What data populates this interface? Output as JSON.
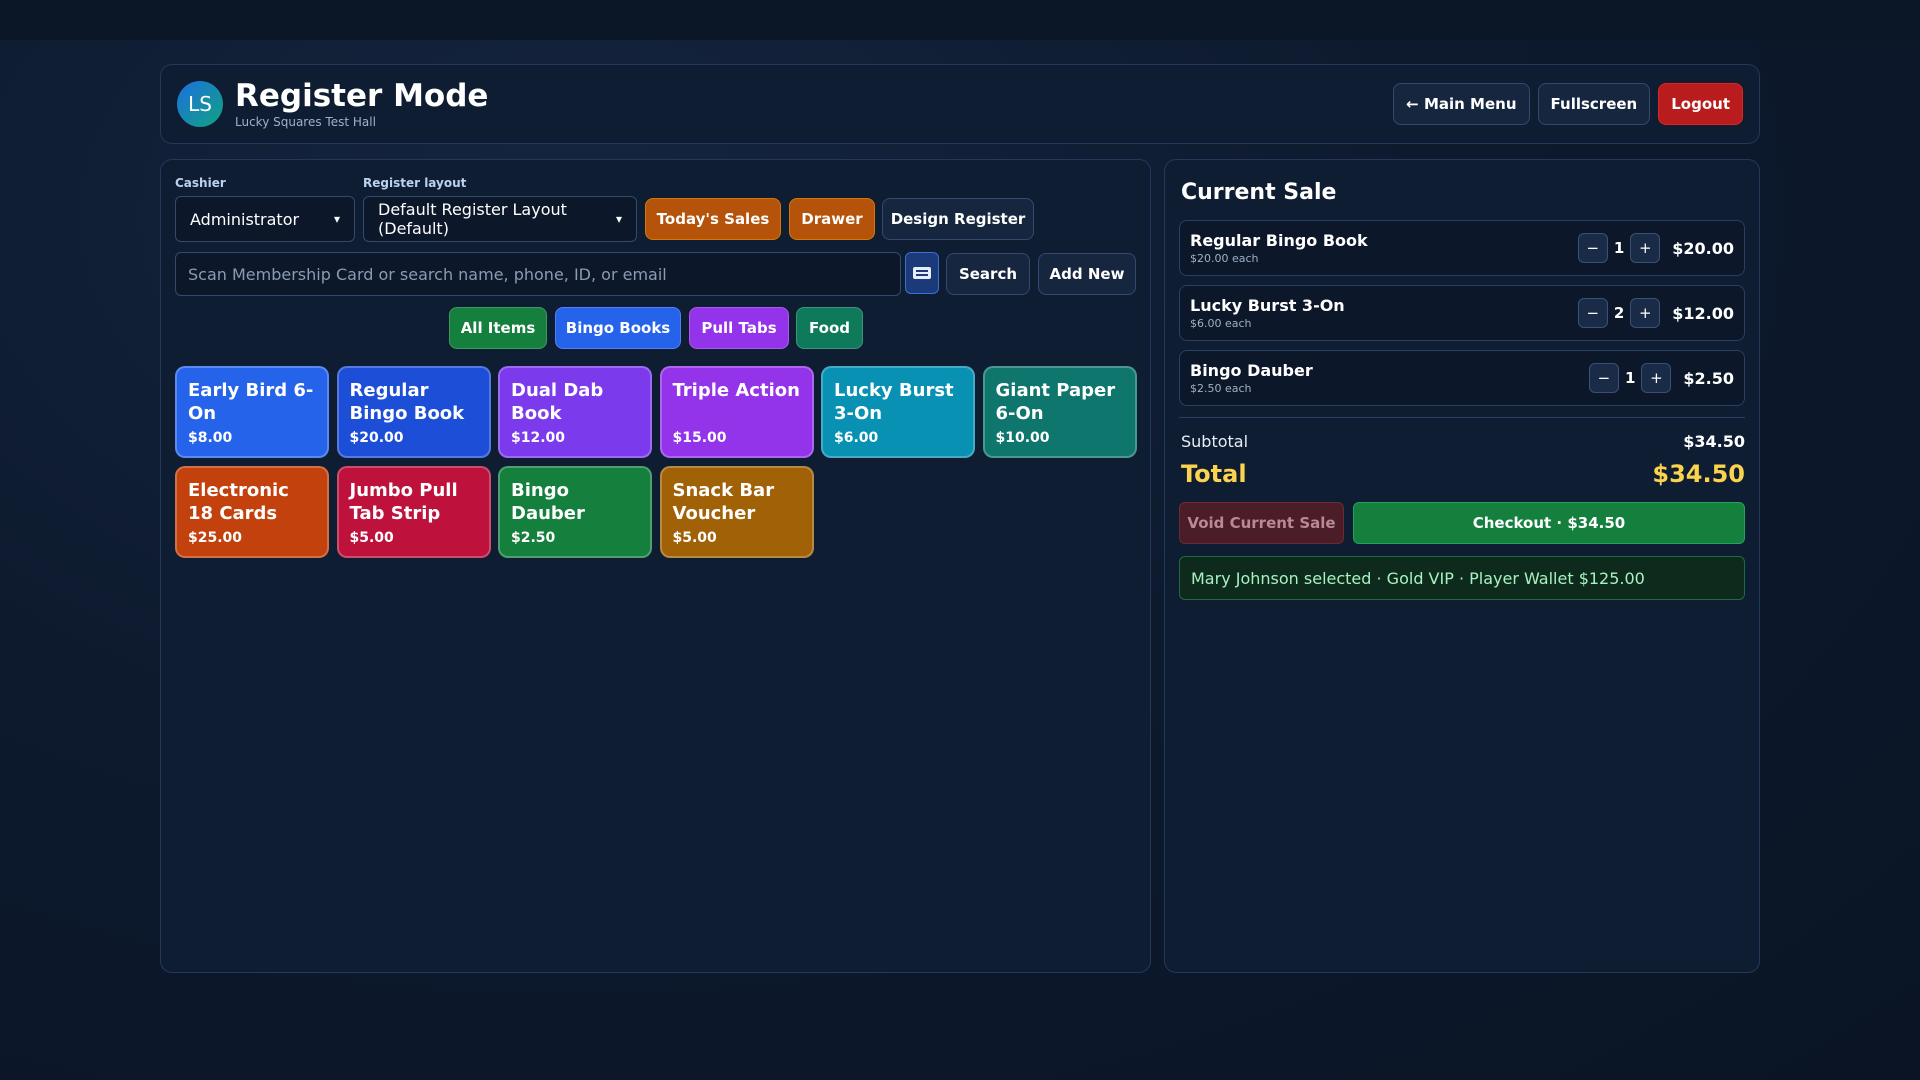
{
  "header": {
    "logo_initials": "LS",
    "title": "Register Mode",
    "subtitle": "Lucky Squares Test Hall",
    "buttons": {
      "main_menu": "← Main Menu",
      "fullscreen": "Fullscreen",
      "logout": "Logout"
    }
  },
  "controls": {
    "cashier_label": "Cashier",
    "cashier_value": "Administrator",
    "layout_label": "Register layout",
    "layout_value": "Default Register Layout (Default)",
    "todays_sales": "Today's Sales",
    "drawer": "Drawer",
    "design_register": "Design Register",
    "search_placeholder": "Scan Membership Card or search name, phone, ID, or email",
    "search_button": "Search",
    "add_new_button": "Add New"
  },
  "categories": [
    {
      "label": "All Items",
      "color": "#15803d"
    },
    {
      "label": "Bingo Books",
      "color": "#2563eb"
    },
    {
      "label": "Pull Tabs",
      "color": "#9333ea"
    },
    {
      "label": "Food",
      "color": "#0f7a5a"
    }
  ],
  "products": [
    {
      "name": "Early Bird 6-On",
      "price": "$8.00",
      "color": "#2563eb"
    },
    {
      "name": "Regular Bingo Book",
      "price": "$20.00",
      "color": "#1d4ed8"
    },
    {
      "name": "Dual Dab Book",
      "price": "$12.00",
      "color": "#7c3aed"
    },
    {
      "name": "Triple Action",
      "price": "$15.00",
      "color": "#9333ea"
    },
    {
      "name": "Lucky Burst 3-On",
      "price": "$6.00",
      "color": "#0891b2"
    },
    {
      "name": "Giant Paper 6-On",
      "price": "$10.00",
      "color": "#0f766e"
    },
    {
      "name": "Electronic 18 Cards",
      "price": "$25.00",
      "color": "#c2410c"
    },
    {
      "name": "Jumbo Pull Tab Strip",
      "price": "$5.00",
      "color": "#be123c"
    },
    {
      "name": "Bingo Dauber",
      "price": "$2.50",
      "color": "#15803d"
    },
    {
      "name": "Snack Bar Voucher",
      "price": "$5.00",
      "color": "#a16207"
    }
  ],
  "sale": {
    "title": "Current Sale",
    "items": [
      {
        "name": "Regular Bingo Book",
        "each": "$20.00 each",
        "qty": "1",
        "total": "$20.00"
      },
      {
        "name": "Lucky Burst 3-On",
        "each": "$6.00 each",
        "qty": "2",
        "total": "$12.00"
      },
      {
        "name": "Bingo Dauber",
        "each": "$2.50 each",
        "qty": "1",
        "total": "$2.50"
      }
    ],
    "minus": "−",
    "plus": "+",
    "subtotal_label": "Subtotal",
    "subtotal": "$34.50",
    "total_label": "Total",
    "total": "$34.50",
    "void_label": "Void Current Sale",
    "checkout_label": "Checkout · $34.50",
    "status": "Mary Johnson selected · Gold VIP · Player Wallet $125.00"
  }
}
